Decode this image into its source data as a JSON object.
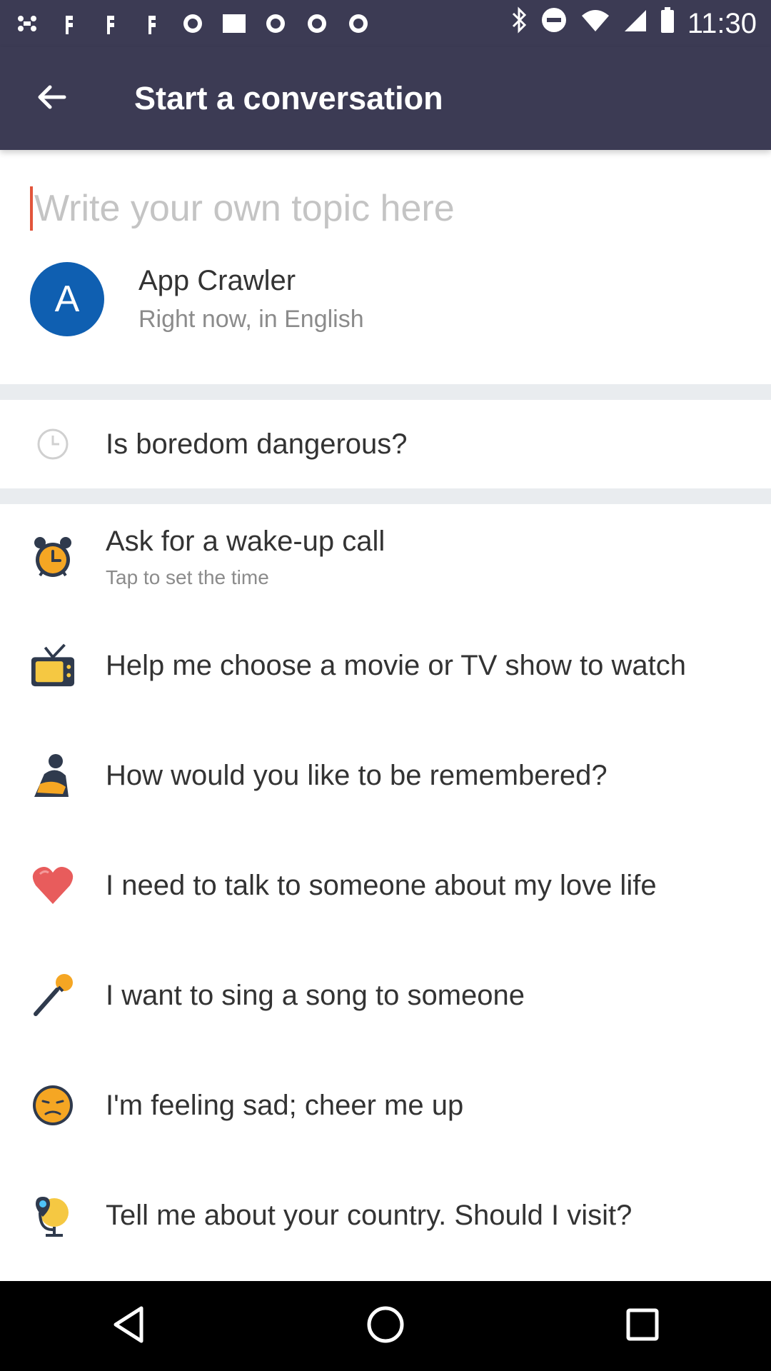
{
  "status_bar": {
    "time": "11:30",
    "icons": [
      "slack-icon",
      "facebook-icon",
      "facebook-icon",
      "facebook-icon",
      "abc13-icon",
      "image-icon",
      "abc13-icon",
      "abc13-icon",
      "abc13-icon",
      "bluetooth-icon",
      "do-not-disturb-icon",
      "wifi-icon",
      "signal-icon",
      "battery-icon"
    ]
  },
  "app_bar": {
    "title": "Start a conversation",
    "back_icon": "arrow-back-icon"
  },
  "topic_input": {
    "placeholder": "Write your own topic here",
    "value": ""
  },
  "user": {
    "initial": "A",
    "name": "App Crawler",
    "subtitle": "Right now, in English",
    "avatar_color": "#0f5fb1"
  },
  "recent": {
    "icon": "clock-icon",
    "title": "Is boredom dangerous?"
  },
  "suggestions": [
    {
      "icon": "alarm-clock-icon",
      "title": "Ask for a wake-up call",
      "subtitle": "Tap to set the time"
    },
    {
      "icon": "television-icon",
      "title": "Help me choose a movie or TV show to watch"
    },
    {
      "icon": "person-icon",
      "title": "How would you like to be remembered?"
    },
    {
      "icon": "heart-icon",
      "title": "I need to talk to someone about my love life"
    },
    {
      "icon": "microphone-icon",
      "title": "I want to sing a song to someone"
    },
    {
      "icon": "sad-face-icon",
      "title": "I'm feeling sad; cheer me up"
    },
    {
      "icon": "globe-pin-icon",
      "title": "Tell me about your country. Should I visit?"
    }
  ],
  "nav_bar": {
    "icons": [
      "back-nav-icon",
      "home-nav-icon",
      "recents-nav-icon"
    ]
  },
  "colors": {
    "app_bar": "#3c3b54",
    "accent": "#e2553b",
    "divider": "#e9ecef"
  }
}
